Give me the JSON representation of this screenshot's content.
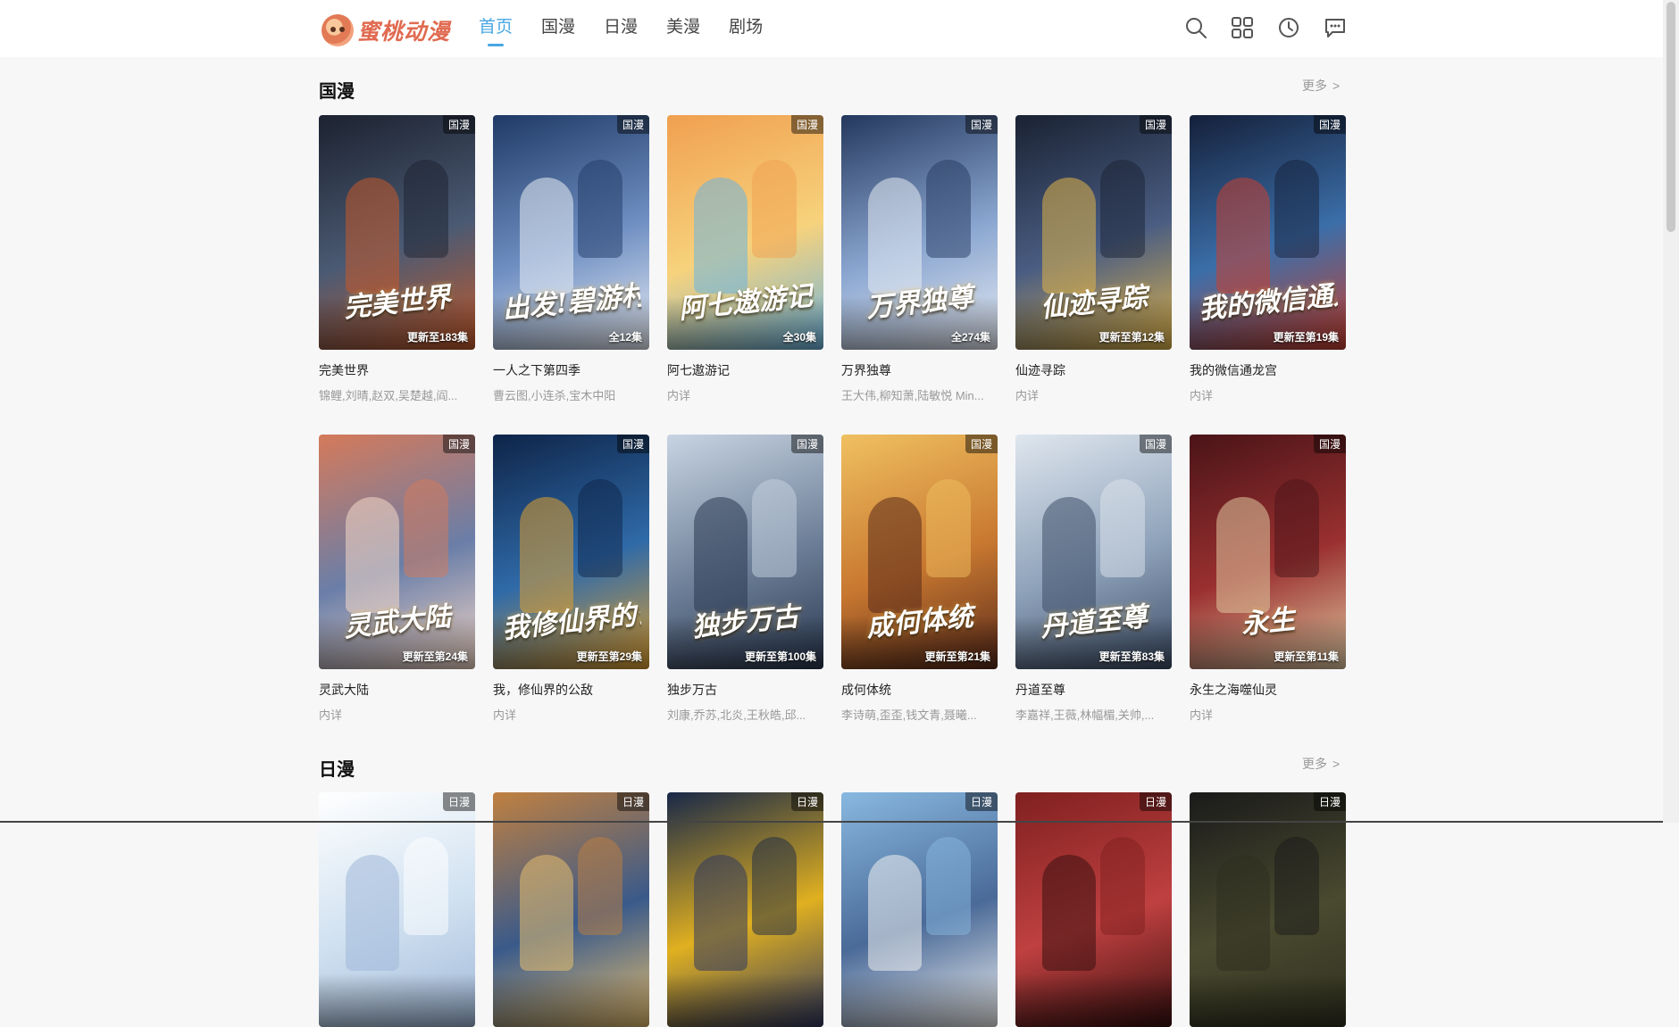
{
  "header": {
    "logo_text": "蜜桃动漫",
    "nav": [
      {
        "label": "首页",
        "active": true
      },
      {
        "label": "国漫",
        "active": false
      },
      {
        "label": "日漫",
        "active": false
      },
      {
        "label": "美漫",
        "active": false
      },
      {
        "label": "剧场",
        "active": false
      }
    ],
    "tools": [
      {
        "name": "search-icon"
      },
      {
        "name": "grid-icon"
      },
      {
        "name": "history-icon"
      },
      {
        "name": "message-icon"
      }
    ]
  },
  "sections": [
    {
      "title": "国漫",
      "more_label": "更多",
      "cards": [
        {
          "tag": "国漫",
          "episode": "更新至183集",
          "name": "完美世界",
          "desc": "锦鲤,刘晴,赵双,吴楚越,阎...",
          "poster_text": "完美世界",
          "colors": [
            "#1c2230",
            "#4b5a73",
            "#c45a2a"
          ]
        },
        {
          "tag": "国漫",
          "episode": "全12集",
          "name": "一人之下第四季",
          "desc": "曹云图,小连杀,宝木中阳",
          "poster_text": "出发!碧游村",
          "colors": [
            "#1f3a66",
            "#6f8fc2",
            "#e9eef6"
          ]
        },
        {
          "tag": "国漫",
          "episode": "全30集",
          "name": "阿七遨游记",
          "desc": "内详",
          "poster_text": "阿七遨游记",
          "colors": [
            "#f0a050",
            "#f7d27c",
            "#6cb5e0"
          ]
        },
        {
          "tag": "国漫",
          "episode": "全274集",
          "name": "万界独尊",
          "desc": "王大伟,柳知萧,陆敏悦 Min...",
          "poster_text": "万界独尊",
          "colors": [
            "#24385e",
            "#8aa6d0",
            "#e8ecf4"
          ]
        },
        {
          "tag": "国漫",
          "episode": "更新至第12集",
          "name": "仙迹寻踪",
          "desc": "内详",
          "poster_text": "仙迹寻踪",
          "colors": [
            "#1a2233",
            "#4a5d82",
            "#e0b44a"
          ]
        },
        {
          "tag": "国漫",
          "episode": "更新至第19集",
          "name": "我的微信通龙宫",
          "desc": "内详",
          "poster_text": "我的微信通龙宫",
          "colors": [
            "#15203a",
            "#3b6ea8",
            "#c84030"
          ]
        }
      ]
    },
    {
      "title": "",
      "more_label": "",
      "cards": [
        {
          "tag": "国漫",
          "episode": "更新至第24集",
          "name": "灵武大陆",
          "desc": "内详",
          "poster_text": "灵武大陆",
          "colors": [
            "#d57a5a",
            "#6a7ea8",
            "#f4d8c8"
          ]
        },
        {
          "tag": "国漫",
          "episode": "更新至第29集",
          "name": "我，修仙界的公敌",
          "desc": "内详",
          "poster_text": "我修仙界的公敌",
          "colors": [
            "#0e2448",
            "#2f6aa8",
            "#e0a030"
          ]
        },
        {
          "tag": "国漫",
          "episode": "更新至第100集",
          "name": "独步万古",
          "desc": "刘康,乔苏,北炎,王秋皓,邱...",
          "poster_text": "独步万古",
          "colors": [
            "#c8d4e2",
            "#6d7f98",
            "#2a3850"
          ]
        },
        {
          "tag": "国漫",
          "episode": "更新至第21集",
          "name": "成何体统",
          "desc": "李诗萌,歪歪,钱文青,聂曦...",
          "poster_text": "成何体统",
          "colors": [
            "#f0c060",
            "#c87830",
            "#5a2a1a"
          ]
        },
        {
          "tag": "国漫",
          "episode": "更新至第83集",
          "name": "丹道至尊",
          "desc": "李嘉祥,王薇,林幅楣,关帅,...",
          "poster_text": "丹道至尊",
          "colors": [
            "#dfe6ee",
            "#8ea2ba",
            "#3e4e68"
          ]
        },
        {
          "tag": "国漫",
          "episode": "更新至第11集",
          "name": "永生之海噬仙灵",
          "desc": "内详",
          "poster_text": "永生",
          "colors": [
            "#4a1418",
            "#9a3030",
            "#e0c8a0"
          ]
        }
      ]
    },
    {
      "title": "日漫",
      "more_label": "更多",
      "cards": [
        {
          "tag": "日漫",
          "colors": [
            "#ffffff",
            "#cfe0f0",
            "#a0b8d8"
          ]
        },
        {
          "tag": "日漫",
          "colors": [
            "#c08040",
            "#3a5a8a",
            "#e8c070"
          ]
        },
        {
          "tag": "日漫",
          "colors": [
            "#182848",
            "#e0b020",
            "#303860"
          ]
        },
        {
          "tag": "日漫",
          "colors": [
            "#88b8e0",
            "#4a6a98",
            "#f0f0f0"
          ]
        },
        {
          "tag": "日漫",
          "colors": [
            "#802020",
            "#c04040",
            "#3a1010"
          ]
        },
        {
          "tag": "日漫",
          "colors": [
            "#1a1a1a",
            "#4a4a30",
            "#303020"
          ]
        }
      ]
    }
  ]
}
